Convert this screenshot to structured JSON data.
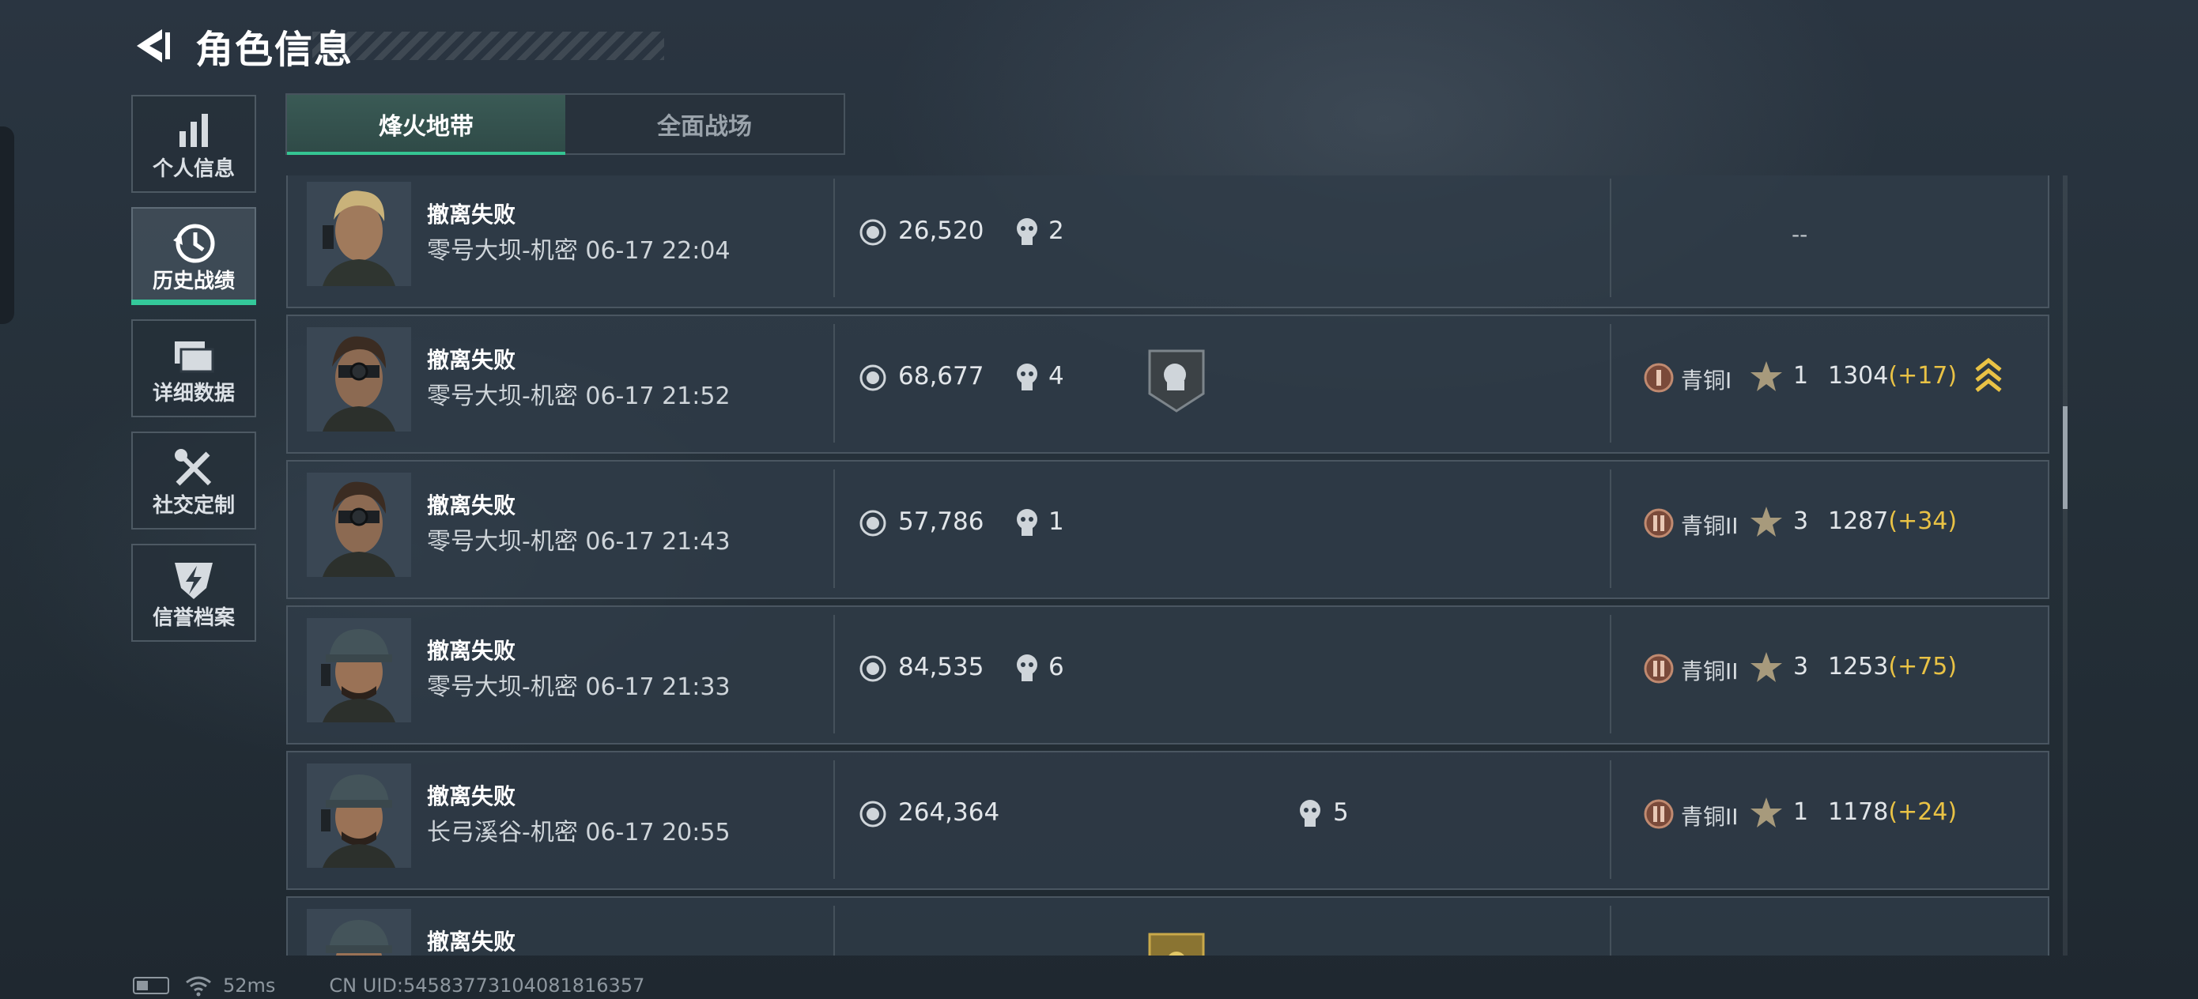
{
  "header": {
    "title": "角色信息",
    "back_icon": "back-arrow-icon"
  },
  "sidenav": [
    {
      "label": "个人信息",
      "icon": "bar-chart-icon",
      "active": false
    },
    {
      "label": "历史战绩",
      "icon": "clock-history-icon",
      "active": true
    },
    {
      "label": "详细数据",
      "icon": "folder-icon",
      "active": false
    },
    {
      "label": "社交定制",
      "icon": "tools-icon",
      "active": false
    },
    {
      "label": "信誉档案",
      "icon": "shield-lightning-icon",
      "active": false
    }
  ],
  "tabs": [
    {
      "label": "烽火地带",
      "active": true
    },
    {
      "label": "全面战场",
      "active": false
    }
  ],
  "matches": [
    {
      "result": "撤离失败",
      "map": "零号大坝-机密 06-17 22:04",
      "value": "26,520",
      "kills": "2",
      "badge": "",
      "rank": "",
      "stars": "",
      "score": "",
      "delta": "",
      "placeholder": "--",
      "avatar": "blond-operator"
    },
    {
      "result": "撤离失败",
      "map": "零号大坝-机密 06-17 21:52",
      "value": "68,677",
      "kills": "4",
      "badge": "shield-badge",
      "rank": "青铜I",
      "stars": "1",
      "score": "1304",
      "delta": "(+17)",
      "placeholder": "",
      "avatar": "nightvision-operator"
    },
    {
      "result": "撤离失败",
      "map": "零号大坝-机密 06-17 21:43",
      "value": "57,786",
      "kills": "1",
      "badge": "",
      "rank": "青铜II",
      "stars": "3",
      "score": "1287",
      "delta": "(+34)",
      "placeholder": "",
      "avatar": "nightvision-operator"
    },
    {
      "result": "撤离失败",
      "map": "零号大坝-机密 06-17 21:33",
      "value": "84,535",
      "kills": "6",
      "badge": "",
      "rank": "青铜II",
      "stars": "3",
      "score": "1253",
      "delta": "(+75)",
      "placeholder": "",
      "avatar": "cap-operator"
    },
    {
      "result": "撤离失败",
      "map": "长弓溪谷-机密 06-17 20:55",
      "value": "264,364",
      "kills": "5",
      "badge": "",
      "rank": "青铜II",
      "stars": "1",
      "score": "1178",
      "delta": "(+24)",
      "placeholder": "",
      "avatar": "cap-operator"
    },
    {
      "result": "撤离失败",
      "map": "",
      "value": "",
      "kills": "",
      "badge": "gold-badge",
      "rank": "",
      "stars": "",
      "score": "",
      "delta": "",
      "placeholder": "",
      "avatar": "cap-operator"
    }
  ],
  "status": {
    "ping": "52ms",
    "uid": "CN UID:54583773104081816357"
  },
  "colors": {
    "accent": "#34c89a",
    "delta": "#e9c245",
    "row_bg": "#303c48"
  }
}
